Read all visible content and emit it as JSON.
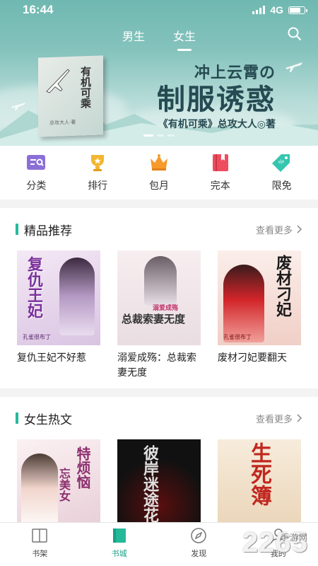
{
  "status": {
    "time": "16:44",
    "network": "4G"
  },
  "top_tabs": [
    {
      "label": "男生"
    },
    {
      "label": "女生"
    }
  ],
  "banner": {
    "book_title_vertical": "有机可乘",
    "book_author": "总攻大人·著",
    "headline_line1": "冲上云霄の",
    "headline_line2": "制服诱惑",
    "headline_line3": "《有机可乘》总攻大人◎著"
  },
  "nav": [
    {
      "label": "分类",
      "icon": "category-icon",
      "color": "#8b6fd6"
    },
    {
      "label": "排行",
      "icon": "trophy-icon",
      "color": "#f2b632"
    },
    {
      "label": "包月",
      "icon": "crown-icon",
      "color": "#f59a2b"
    },
    {
      "label": "完本",
      "icon": "book-icon",
      "color": "#ee4d5f"
    },
    {
      "label": "限免",
      "icon": "tag-icon",
      "color": "#36c6b0"
    }
  ],
  "sections": [
    {
      "title": "精品推荐",
      "more": "查看更多",
      "books": [
        {
          "title": "复仇王妃不好惹",
          "cover_text": "复仇王妃",
          "cover_sub": "孔雀很布丁",
          "bg": "#efe4f1",
          "fg": "#7a2f9b"
        },
        {
          "title": "溺爱成殇：总裁索妻无度",
          "cover_text": "总裁索妻无度",
          "cover_sub": "溺爱成殇",
          "bg": "#efe6ea",
          "fg": "#3a3a3a"
        },
        {
          "title": "废材刁妃要翻天",
          "cover_text": "废材刁妃",
          "cover_sub": "孔雀很布丁",
          "bg": "#f6e3e0",
          "fg": "#9b1d1d"
        }
      ]
    },
    {
      "title": "女生热文",
      "more": "查看更多",
      "books": [
        {
          "title": "",
          "cover_text": "特烦恼",
          "cover_sub": "忘美女",
          "bg": "#f3e6ea",
          "fg": "#8c2f6e"
        },
        {
          "title": "",
          "cover_text": "彼岸迷途花",
          "cover_sub": "",
          "bg": "#151515",
          "fg": "#d8d8d8"
        },
        {
          "title": "",
          "cover_text": "生死簿",
          "cover_sub": "",
          "bg": "#f4e8d8",
          "fg": "#c0271f"
        }
      ]
    }
  ],
  "tabbar": [
    {
      "label": "书架",
      "icon": "bookshelf-icon"
    },
    {
      "label": "书城",
      "icon": "bookstore-icon"
    },
    {
      "label": "发现",
      "icon": "compass-icon"
    },
    {
      "label": "我的",
      "icon": "profile-icon"
    }
  ],
  "watermark": {
    "text": "2265",
    "sub": "手游网"
  },
  "colors": {
    "accent": "#25b99a",
    "tab_active": "#1a9f85"
  }
}
